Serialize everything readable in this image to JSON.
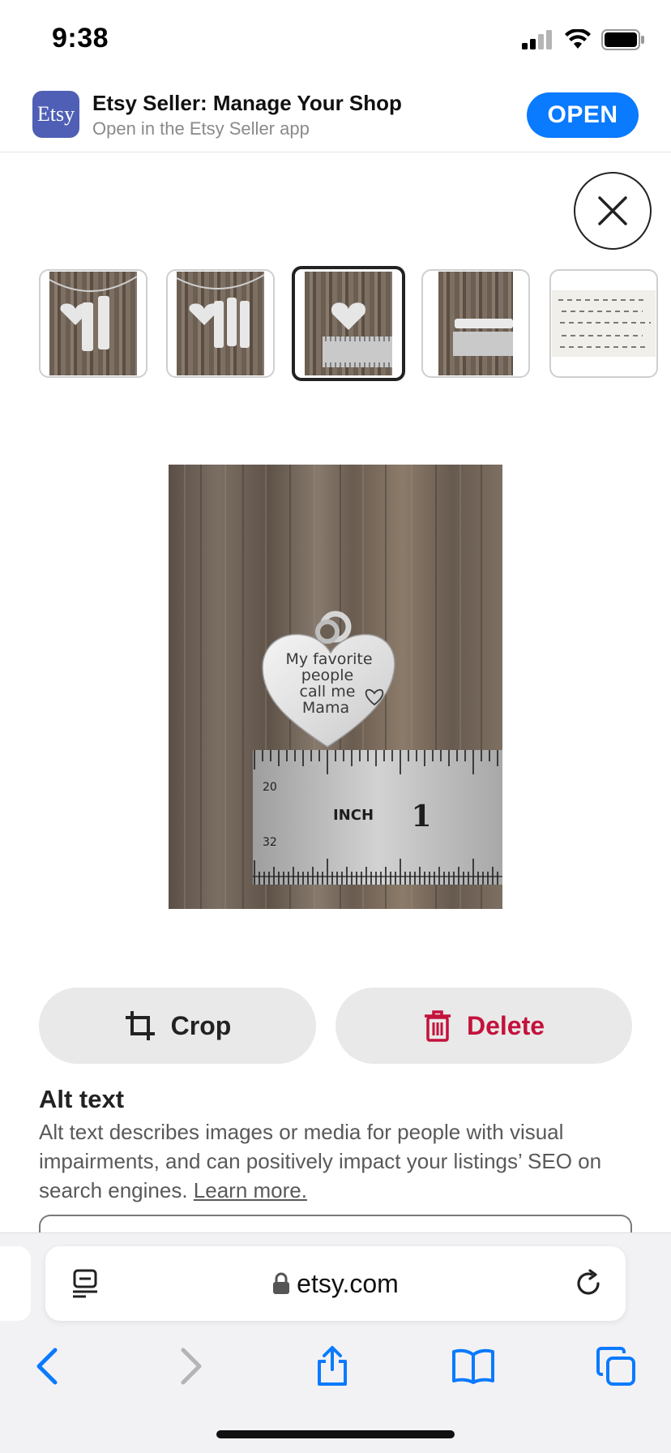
{
  "status_bar": {
    "time": "9:38"
  },
  "app_banner": {
    "logo_text": "Etsy",
    "title": "Etsy Seller: Manage Your Shop",
    "subtitle": "Open in the Etsy Seller app",
    "open_label": "OPEN"
  },
  "thumbnails": [
    {
      "name": "thumb-1",
      "selected": false
    },
    {
      "name": "thumb-2",
      "selected": false
    },
    {
      "name": "thumb-3",
      "selected": true
    },
    {
      "name": "thumb-4",
      "selected": false
    },
    {
      "name": "thumb-5",
      "selected": false
    }
  ],
  "main_image": {
    "charm_lines": [
      "My favorite",
      "people",
      "call me",
      "Mama"
    ],
    "ruler_label": "INCH",
    "ruler_number": "1",
    "ruler_top_mark": "20",
    "ruler_bottom_mark": "32"
  },
  "actions": {
    "crop_label": "Crop",
    "delete_label": "Delete"
  },
  "alt_text": {
    "title": "Alt text",
    "description": "Alt text describes images or media for people with visual impairments, and can positively impact your listings’ SEO on search engines.",
    "link": "Learn more."
  },
  "browser": {
    "url": "etsy.com"
  },
  "colors": {
    "open_button": "#0a7aff",
    "delete_text": "#c3123c",
    "safari_icon": "#0a7aff",
    "etsy_logo": "#4f5fb5"
  }
}
